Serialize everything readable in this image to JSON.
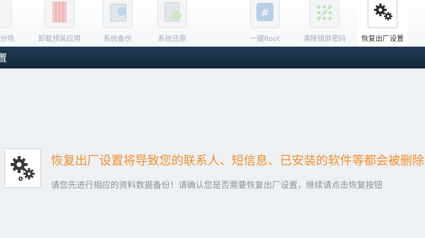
{
  "toolbar": {
    "items": [
      {
        "label": "分场",
        "icon": "app-icon"
      },
      {
        "label": "卸载预装应用",
        "icon": "uninstall-icon"
      },
      {
        "label": "系统备份",
        "icon": "backup-icon"
      },
      {
        "label": "系统还原",
        "icon": "restore-icon"
      },
      {
        "label": "一键Root",
        "icon": "root-icon"
      },
      {
        "label": "清除锁屏密码",
        "icon": "pattern-lock-icon"
      },
      {
        "label": "恢复出厂设置",
        "icon": "gears-icon"
      }
    ],
    "active": "恢复出厂设置"
  },
  "header": {
    "title": "置"
  },
  "main": {
    "title": "恢复出厂设置将导致您的联系人、短信息、已安装的软件等都会被删除",
    "description": "请您先进行相应的资料数据备份！请确认您是否需要恢复出厂设置，继续请点击恢复按钮"
  },
  "colors": {
    "accent": "#f0902c",
    "header": "#1b3349",
    "background": "#eef1f4"
  }
}
